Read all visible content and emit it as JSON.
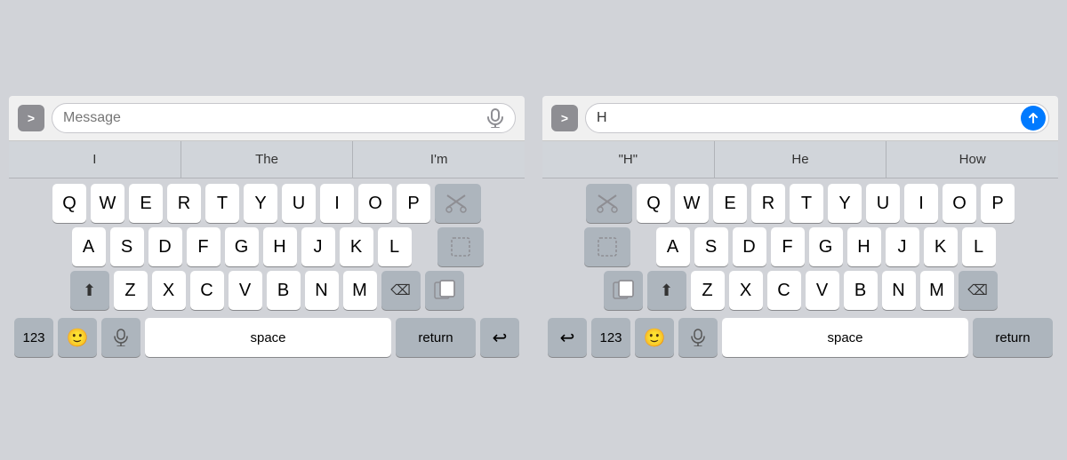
{
  "panels": [
    {
      "id": "panel-left",
      "input": {
        "placeholder": "Message",
        "value": "",
        "has_cursor": true
      },
      "has_send": false,
      "has_mic": true,
      "predictive": [
        "I",
        "The",
        "I'm"
      ],
      "rows": [
        [
          "Q",
          "W",
          "E",
          "R",
          "T",
          "Y",
          "U",
          "I",
          "O",
          "P"
        ],
        [
          "A",
          "S",
          "D",
          "F",
          "G",
          "H",
          "J",
          "K",
          "L"
        ],
        [
          "Z",
          "X",
          "C",
          "V",
          "B",
          "N",
          "M"
        ]
      ],
      "bottom": {
        "num": "123",
        "emoji": "😊",
        "mic": "🎙",
        "space": "space",
        "return": "return",
        "undo": "↩"
      },
      "right_column": {
        "cut": "✂",
        "clipboard_dashed": "⊡",
        "paste": "⧉"
      }
    },
    {
      "id": "panel-right",
      "input": {
        "placeholder": "",
        "value": "H",
        "has_cursor": false
      },
      "has_send": true,
      "has_mic": false,
      "predictive": [
        "\"H\"",
        "He",
        "How"
      ],
      "rows": [
        [
          "Q",
          "W",
          "E",
          "R",
          "T",
          "Y",
          "U",
          "I",
          "O",
          "P"
        ],
        [
          "A",
          "S",
          "D",
          "F",
          "G",
          "H",
          "J",
          "K",
          "L"
        ],
        [
          "Z",
          "X",
          "C",
          "V",
          "B",
          "N",
          "M"
        ]
      ],
      "bottom": {
        "num": "123",
        "emoji": "😊",
        "mic": "🎙",
        "space": "space",
        "return": "return",
        "undo": "↩"
      },
      "left_column": {
        "cut": "✂",
        "clipboard_dashed": "⊡",
        "paste": "⧉"
      }
    }
  ],
  "colors": {
    "key_bg": "#ffffff",
    "special_key_bg": "#adb5bd",
    "keyboard_bg": "#d1d3d8",
    "send_blue": "#007aff",
    "arrow_gray": "#8e8e93"
  }
}
